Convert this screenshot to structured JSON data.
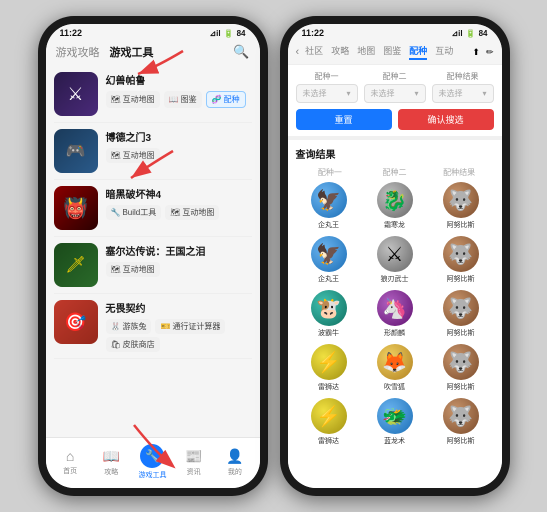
{
  "left_phone": {
    "status": {
      "time": "11:22",
      "signal": "⊿il",
      "battery": "84"
    },
    "header": {
      "tab_inactive": "游戏攻略",
      "tab_active": "游戏工具"
    },
    "games": [
      {
        "id": "fantasy",
        "title": "幻兽帕鲁",
        "tags": [
          "互动地图",
          "图鉴",
          "配种"
        ],
        "tag_highlight": "配种",
        "thumb_class": "thumb-fantasy",
        "thumb_symbol": "⚔"
      },
      {
        "id": "botw",
        "title": "博德之门3",
        "tags": [
          "互动地图"
        ],
        "thumb_class": "thumb-botw",
        "thumb_symbol": "🎮"
      },
      {
        "id": "diablo",
        "title": "暗黑破坏神4",
        "tags": [
          "Build工具",
          "互动地图"
        ],
        "thumb_class": "thumb-diablo",
        "thumb_symbol": "👹"
      },
      {
        "id": "zelda",
        "title": "塞尔达传说：王国之泪",
        "tags": [
          "互动地图"
        ],
        "thumb_class": "thumb-zelda",
        "thumb_symbol": "🗡"
      },
      {
        "id": "nofence",
        "title": "无畏契约",
        "tags": [
          "游族兔",
          "通行证计算器",
          "皮肤商店"
        ],
        "thumb_class": "thumb-nofence",
        "thumb_symbol": "🎯"
      }
    ],
    "nav": [
      {
        "label": "首页",
        "icon": "⌂",
        "active": false
      },
      {
        "label": "攻略",
        "icon": "📖",
        "active": false
      },
      {
        "label": "游戏工具",
        "icon": "🔧",
        "active": true
      },
      {
        "label": "资讯",
        "icon": "📰",
        "active": false
      },
      {
        "label": "我的",
        "icon": "👤",
        "active": false
      }
    ]
  },
  "right_phone": {
    "status": {
      "time": "11:22",
      "signal": "⊿il",
      "battery": "84"
    },
    "header": {
      "back": "‹",
      "tabs": [
        "社区",
        "攻略",
        "地图",
        "图鉴",
        "配种",
        "互动"
      ],
      "active_tab": "配种",
      "share_icon": "⬆",
      "edit_icon": "✏"
    },
    "breed_form": {
      "col1_label": "配种一",
      "col2_label": "配种二",
      "col3_label": "配种结果",
      "placeholder": "未选择",
      "btn_reset": "重置",
      "btn_confirm": "确认搜选"
    },
    "results": {
      "title": "查询结果",
      "headers": [
        "配种一",
        "配种二",
        "配种结果"
      ],
      "rows": [
        {
          "p1_name": "企丸王",
          "p1_color": "poke-blue",
          "p2_name": "霜寒龙",
          "p2_color": "poke-gray",
          "p3_name": "阿努比斯",
          "p3_color": "poke-brown"
        },
        {
          "p1_name": "企丸王",
          "p1_color": "poke-blue",
          "p2_name": "狼刃武士",
          "p2_color": "poke-gray",
          "p3_name": "阿努比斯",
          "p3_color": "poke-brown"
        },
        {
          "p1_name": "波霸牛",
          "p1_color": "poke-teal",
          "p2_name": "形颜麟",
          "p2_color": "poke-purple",
          "p3_name": "阿努比斯",
          "p3_color": "poke-brown"
        },
        {
          "p1_name": "雷狮达",
          "p1_color": "poke-yellow",
          "p2_name": "吹雪狐",
          "p2_color": "poke-gold",
          "p3_name": "阿努比斯",
          "p3_color": "poke-brown"
        },
        {
          "p1_name": "雷狮达",
          "p1_color": "poke-yellow",
          "p2_name": "蓝龙术",
          "p2_color": "poke-blue",
          "p3_name": "阿努比斯",
          "p3_color": "poke-brown"
        }
      ]
    }
  }
}
